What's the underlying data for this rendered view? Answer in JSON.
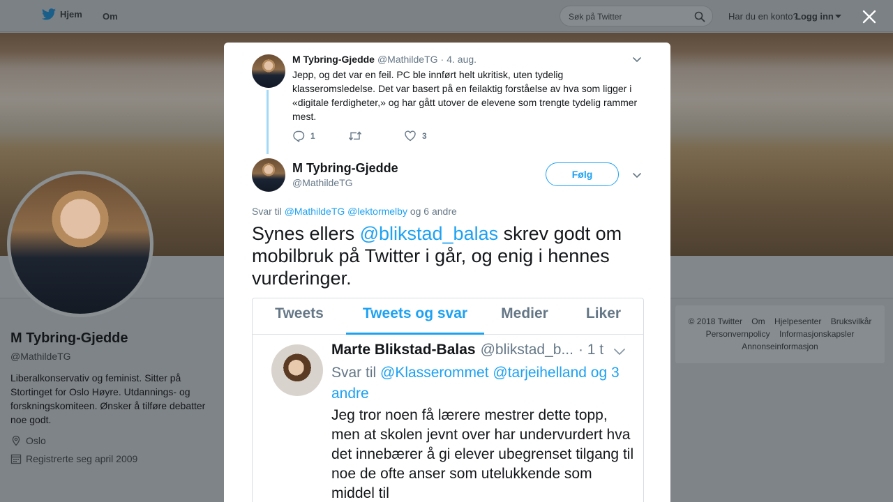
{
  "topbar": {
    "home_label": "Hjem",
    "about_label": "Om",
    "search_placeholder": "Søk på Twitter",
    "account_prompt": "Har du en konto?",
    "login_label": "Logg inn"
  },
  "profile": {
    "name": "M Tybring-Gjedde",
    "handle": "@MathildeTG",
    "bio": "Liberalkonservativ og feminist. Sitter på Stortinget for Oslo Høyre. Utdannings- og forskningskomiteen. Ønsker å tilføre debatter noe godt.",
    "location": "Oslo",
    "joined": "Registrerte seg april 2009"
  },
  "footer": {
    "links": [
      "© 2018 Twitter",
      "Om",
      "Hjelpesenter",
      "Bruksvilkår",
      "Personvernpolicy",
      "Informasjonskapsler",
      "Annonseinformasjon"
    ]
  },
  "modal": {
    "parent_tweet": {
      "name": "M Tybring-Gjedde",
      "handle": "@MathildeTG",
      "separator": "·",
      "date": "4. aug.",
      "text": "Jepp, og det var en feil. PC ble innført helt ukritisk, uten tydelig klasseromsledelse. Det var basert på en feilaktig forståelse av hva som ligger i «digitale ferdigheter,» og har gått utover de elevene som trengte tydelig rammer mest.",
      "reply_count": "1",
      "retweet_count": "",
      "like_count": "3"
    },
    "main_tweet": {
      "name": "M Tybring-Gjedde",
      "handle": "@MathildeTG",
      "follow_label": "Følg",
      "reply_prefix": "Svar til",
      "reply_mention_1": "@MathildeTG",
      "reply_mention_2": "@lektormelby",
      "reply_suffix": "og 6 andre",
      "text_before": "Synes ellers ",
      "text_mention": "@blikstad_balas",
      "text_after": " skrev godt om mobilbruk på Twitter i går, og enig i hennes vurderinger."
    },
    "embedded": {
      "tabs": [
        "Tweets",
        "Tweets og svar",
        "Medier",
        "Liker"
      ],
      "active_tab": 1,
      "name": "Marte Blikstad-Balas",
      "handle": "@blikstad_b...",
      "time": "· 1 t",
      "reply_prefix": "Svar til",
      "reply_mentions": "@Klasserommet @tarjeihelland",
      "reply_suffix": "og 3 andre",
      "text": "Jeg tror noen få lærere mestrer dette topp, men at skolen jevnt over har undervurdert hva det innebærer å gi elever ubegrenset tilgang til noe de ofte anser som utelukkende som middel til"
    }
  },
  "colors": {
    "accent": "#1da1f2",
    "muted": "#657786",
    "text": "#14171a",
    "thread_line": "#a2d9f5"
  },
  "icons": [
    "twitter-bird-icon",
    "search-icon",
    "caret-down-icon",
    "close-icon",
    "chevron-down-icon",
    "reply-icon",
    "retweet-icon",
    "heart-icon",
    "location-icon",
    "calendar-icon"
  ]
}
